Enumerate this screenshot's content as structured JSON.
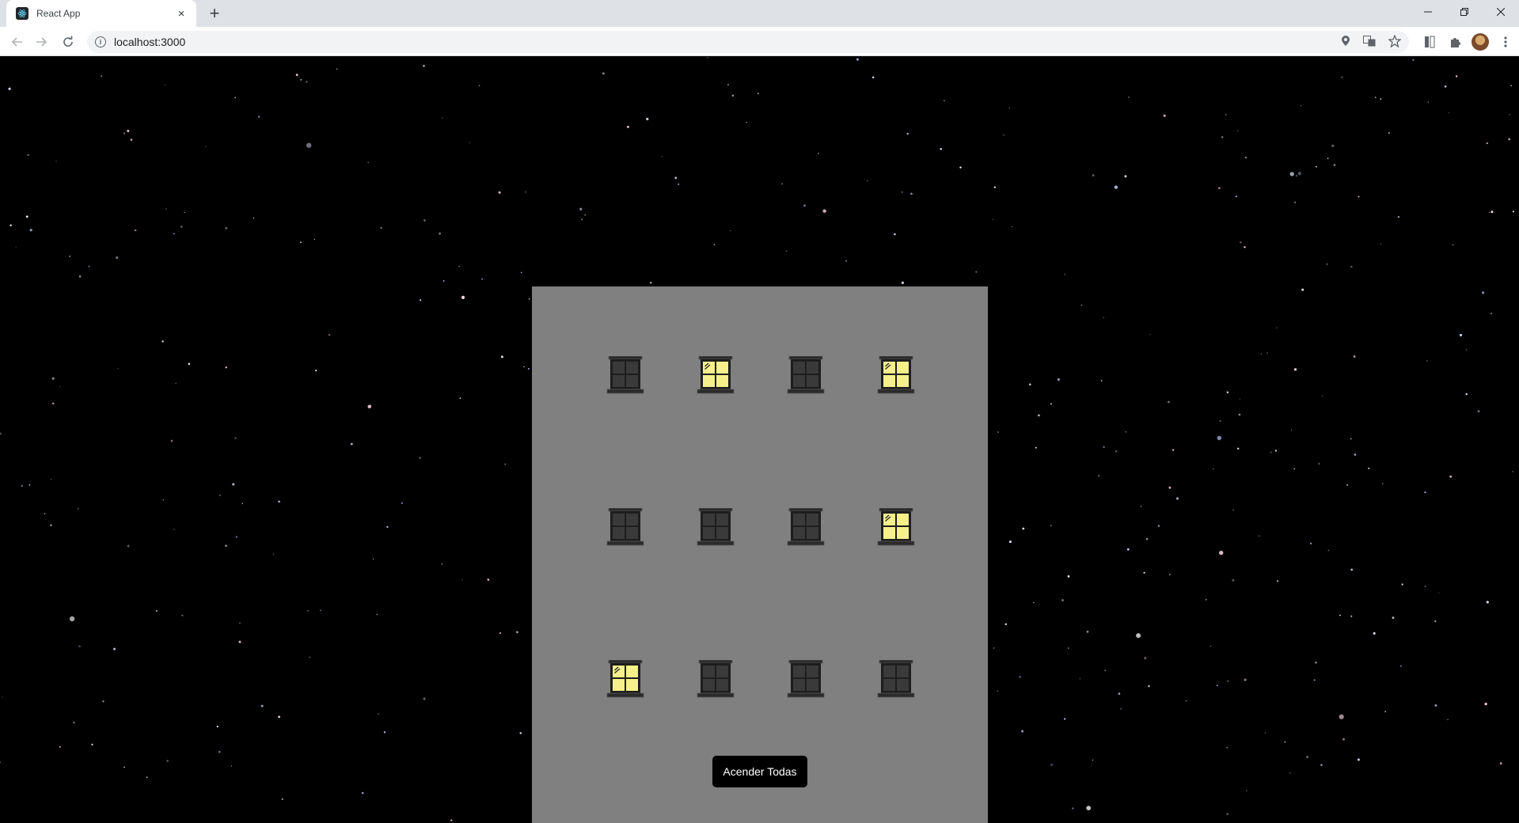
{
  "browser": {
    "tab_title": "React App",
    "tab_close": "×",
    "new_tab": "+",
    "url": "localhost:3000"
  },
  "page": {
    "background_color": "#000000",
    "building_color": "#808080",
    "window_on_color": "#f5f08c",
    "window_off_color": "#3a3a3a",
    "windows": [
      {
        "row": 1,
        "col": 1,
        "lit": false
      },
      {
        "row": 1,
        "col": 2,
        "lit": true
      },
      {
        "row": 1,
        "col": 3,
        "lit": false
      },
      {
        "row": 1,
        "col": 4,
        "lit": true
      },
      {
        "row": 2,
        "col": 1,
        "lit": false
      },
      {
        "row": 2,
        "col": 2,
        "lit": false
      },
      {
        "row": 2,
        "col": 3,
        "lit": false
      },
      {
        "row": 2,
        "col": 4,
        "lit": true
      },
      {
        "row": 3,
        "col": 1,
        "lit": true
      },
      {
        "row": 3,
        "col": 2,
        "lit": false
      },
      {
        "row": 3,
        "col": 3,
        "lit": false
      },
      {
        "row": 3,
        "col": 4,
        "lit": false
      }
    ],
    "button_label": "Acender Todas"
  }
}
